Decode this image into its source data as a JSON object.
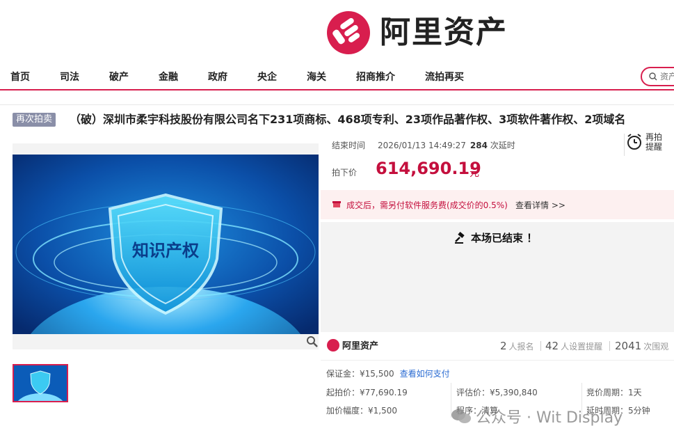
{
  "brand": {
    "name": "阿里资产",
    "color": "#d81e4e"
  },
  "nav": {
    "items": [
      "首页",
      "司法",
      "破产",
      "金融",
      "政府",
      "央企",
      "海关",
      "招商推介",
      "流拍再买"
    ],
    "search_placeholder": "资产"
  },
  "auction": {
    "badge": "再次拍卖",
    "title": "（破）深圳市柔宇科技股份有限公司名下231项商标、468项专利、23项作品著作权、3项软件著作权、2项域名",
    "image_caption": "知识产权",
    "end_time_label": "结束时间",
    "end_time_value": "2026/01/13 14:49:27",
    "delay_count": "284",
    "delay_label": "次延时",
    "alarm_label_1": "再拍",
    "alarm_label_2": "提醒",
    "price_label": "拍下价",
    "price_value": "614,690.19",
    "price_unit": "元",
    "fee_text": "成交后，需另付软件服务费(成交价的0.5%)",
    "fee_link": "查看详情 >>",
    "ended_text": "本场已结束 ！"
  },
  "stats": {
    "small_brand": "阿里资产",
    "signups_num": "2",
    "signups_label": "人报名",
    "reminders_num": "42",
    "reminders_label": "人设置提醒",
    "views_num": "2041",
    "views_label": "次围观"
  },
  "details": {
    "deposit": "保证金：¥15,500",
    "deposit_link": "查看如何支付",
    "start_price": "起拍价：¥77,690.19",
    "appraisal": "评估价：¥5,390,840",
    "cycle": "竞价周期：1天",
    "increment": "加价幅度：¥1,500",
    "procedure": "程序：清算",
    "delay_cycle": "延时周期：5分钟"
  },
  "watermark": {
    "text": "公众号 · Wit Display"
  }
}
